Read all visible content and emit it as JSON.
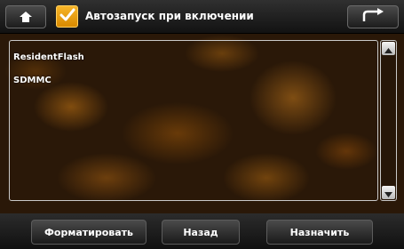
{
  "header": {
    "title": "Автозапуск при включении",
    "autostart_checked": true,
    "home_icon": "home-icon",
    "back_icon": "return-arrow-icon"
  },
  "list": {
    "items": [
      {
        "label": "ResidentFlash"
      },
      {
        "label": "SDMMC"
      }
    ]
  },
  "footer": {
    "format_label": "Форматировать",
    "back_label": "Назад",
    "assign_label": "Назначить"
  },
  "colors": {
    "accent": "#f0a020",
    "text": "#ffffff",
    "bar": "#1a1a1a"
  }
}
